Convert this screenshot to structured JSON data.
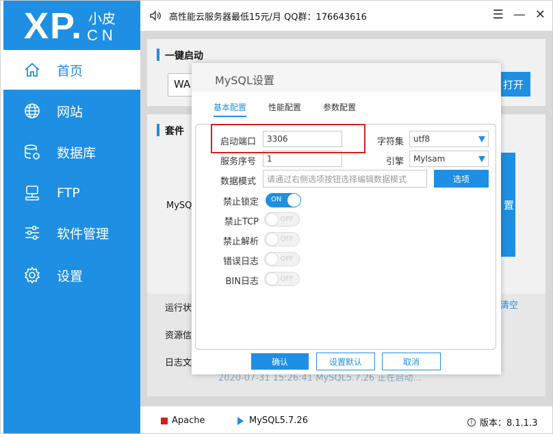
{
  "logo": {
    "main": "XP.",
    "small": "小皮",
    "cn": "CN"
  },
  "sidebar": {
    "items": [
      {
        "label": "首页",
        "icon": "home-icon",
        "active": true
      },
      {
        "label": "网站",
        "icon": "globe-icon"
      },
      {
        "label": "数据库",
        "icon": "database-icon"
      },
      {
        "label": "FTP",
        "icon": "ftp-icon"
      },
      {
        "label": "软件管理",
        "icon": "sliders-icon"
      },
      {
        "label": "设置",
        "icon": "gear-icon"
      }
    ]
  },
  "titlebar": {
    "notice": "高性能云服务器最低15元/月  QQ群：176643616"
  },
  "background": {
    "section1_title": "一键启动",
    "wa_text": "WA",
    "open_btn": "打开",
    "section2_title": "套件",
    "mysq_text": "MySQ",
    "zhi_btn": "置",
    "run_status": "运行状",
    "resource": "资源信",
    "log_file": "日志文",
    "clear_link": "清空",
    "log_line": "2020-07-31 15:26:41 MySQL5.7.26 正在启动..."
  },
  "dialog": {
    "title": "MySQL设置",
    "tabs": [
      "基本配置",
      "性能配置",
      "参数配置"
    ],
    "fields": {
      "port_label": "启动端口",
      "port_value": "3306",
      "charset_label": "字符集",
      "charset_value": "utf8",
      "server_id_label": "服务序号",
      "server_id_value": "1",
      "engine_label": "引擎",
      "engine_value": "MyIsam",
      "data_mode_label": "数据模式",
      "data_mode_placeholder": "请通过右侧选项按钮选择编辑数据模式",
      "option_btn": "选项"
    },
    "toggles": [
      {
        "label": "禁止锁定",
        "state": "ON",
        "on": true
      },
      {
        "label": "禁止TCP",
        "state": "OFF",
        "on": false
      },
      {
        "label": "禁止解析",
        "state": "OFF",
        "on": false
      },
      {
        "label": "错误日志",
        "state": "OFF",
        "on": false
      },
      {
        "label": "BIN日志",
        "state": "OFF",
        "on": false
      }
    ],
    "buttons": {
      "confirm": "确认",
      "default": "设置默认",
      "cancel": "取消"
    }
  },
  "statusbar": {
    "apache": "Apache",
    "mysql": "MySQL5.7.26",
    "version": "版本：8.1.1.3"
  },
  "colors": {
    "accent": "#1e8fe3",
    "highlight": "#d21f1f"
  }
}
